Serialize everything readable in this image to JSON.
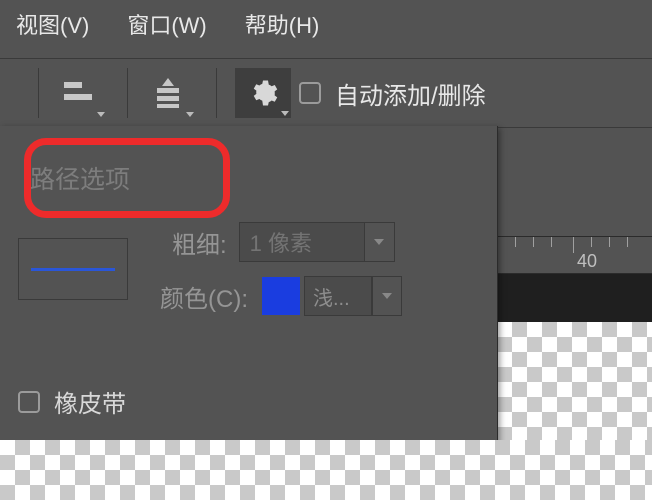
{
  "menubar": {
    "view": "视图(V)",
    "window": "窗口(W)",
    "help": "帮助(H)"
  },
  "toolbar": {
    "auto_add_delete": "自动添加/删除"
  },
  "panel": {
    "title": "路径选项",
    "thickness_label": "粗细:",
    "thickness_value": "1 像素",
    "color_label": "颜色(C):",
    "color_dd_text": "浅...",
    "rubber_band": "橡皮带"
  },
  "ruler": {
    "tick_label": "40"
  }
}
